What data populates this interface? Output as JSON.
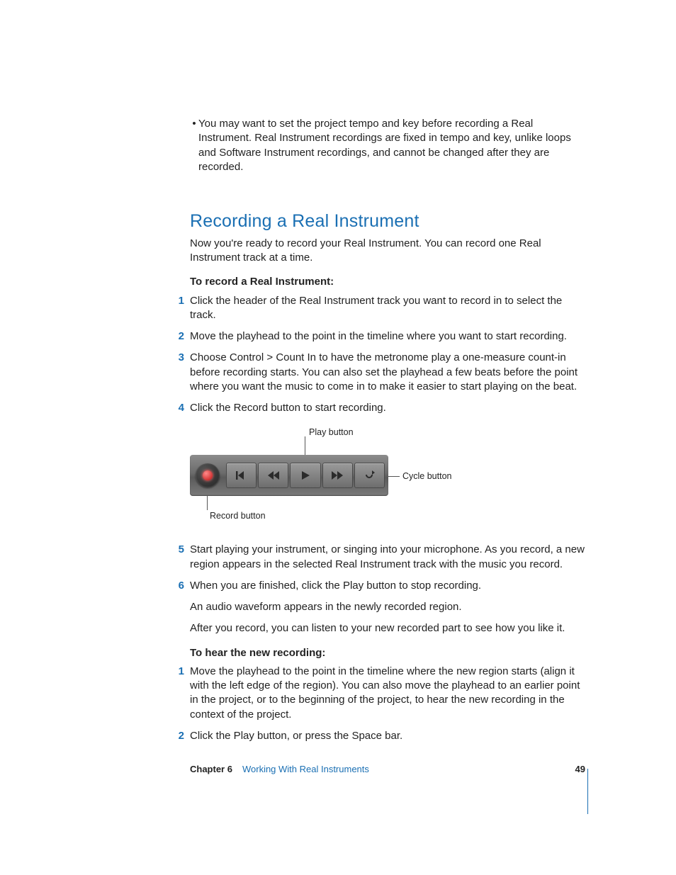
{
  "intro_bullet": "You may want to set the project tempo and key before recording a Real Instrument. Real Instrument recordings are fixed in tempo and key, unlike loops and Software Instrument recordings, and cannot be changed after they are recorded.",
  "heading": "Recording a Real Instrument",
  "heading_intro": "Now you're ready to record your Real Instrument. You can record one Real Instrument track at a time.",
  "subhead1": "To record a Real Instrument:",
  "steps1": [
    "Click the header of the Real Instrument track you want to record in to select the track.",
    "Move the playhead to the point in the timeline where you want to start recording.",
    "Choose Control > Count In to have the metronome play a one-measure count-in before recording starts. You can also set the playhead a few beats before the point where you want the music to come in to make it easier to start playing on the beat.",
    "Click the Record button to start recording."
  ],
  "callouts": {
    "play": "Play button",
    "cycle": "Cycle button",
    "record": "Record button"
  },
  "step5": "Start playing your instrument, or singing into your microphone. As you record, a new region appears in the selected Real Instrument track with the music you record.",
  "step6_a": "When you are finished, click the Play button to stop recording.",
  "step6_b": "An audio waveform appears in the newly recorded region.",
  "step6_c": "After you record, you can listen to your new recorded part to see how you like it.",
  "subhead2": "To hear the new recording:",
  "steps2": [
    "Move the playhead to the point in the timeline where the new region starts (align it with the left edge of the region). You can also move the playhead to an earlier point in the project, or to the beginning of the project, to hear the new recording in the context of the project.",
    "Click the Play button, or press the Space bar."
  ],
  "footer": {
    "chapter": "Chapter 6",
    "title": "Working With Real Instruments",
    "page": "49"
  }
}
